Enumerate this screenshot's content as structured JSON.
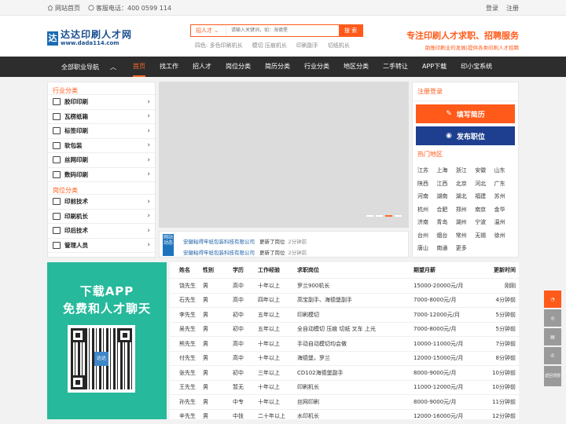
{
  "topbar": {
    "home": "网站首页",
    "phone": "客服电话：400 0599 114",
    "login": "登录",
    "register": "注册"
  },
  "header": {
    "logo_cn": "达达印刷人才网",
    "logo_en": "www.dada114.com",
    "search_type": "招人才",
    "search_placeholder": "请输入关键词，如：海德堡",
    "search_button": "搜 索",
    "hotwords": [
      "四色",
      "多色印刷机长",
      "模切",
      "压痕机长",
      "印刷副手",
      "切纸机长"
    ],
    "slogan_big": "专注印刷人才求职、招聘服务",
    "slogan_small": "助推印刷业的发展|提供各类印刷人才招聘"
  },
  "nav": {
    "all_categories": "全部职业导航",
    "items": [
      "首页",
      "找工作",
      "招人才",
      "岗位分类",
      "简历分类",
      "行业分类",
      "地区分类",
      "二手转让",
      "APP下载",
      "印小宝系统"
    ]
  },
  "categories": {
    "industry_title": "行业分类",
    "industry": [
      "胶印印刷",
      "瓦楞纸箱",
      "标签印刷",
      "软包装",
      "丝网印刷",
      "数码印刷"
    ],
    "position_title": "岗位分类",
    "positions": [
      "印前技术",
      "印刷机长",
      "印后技术",
      "管理人员"
    ]
  },
  "news": {
    "tag": "网站动态",
    "items": [
      {
        "company": "安徽粘得牢纸包装科技有限公司",
        "action": "更新了岗位",
        "time": "2分钟前"
      },
      {
        "company": "安徽粘得牢纸包装科技有限公司",
        "action": "更新了岗位",
        "time": "2分钟前"
      }
    ]
  },
  "side": {
    "login_title": "注册登录",
    "resume_button": "填写简历",
    "post_button": "发布职位",
    "hot_title": "热门地区",
    "cities": [
      "江苏",
      "上海",
      "浙江",
      "安徽",
      "山东",
      "陕西",
      "江西",
      "北京",
      "河北",
      "广东",
      "河南",
      "湖南",
      "湖北",
      "福建",
      "苏州",
      "杭州",
      "合肥",
      "郑州",
      "南京",
      "金华",
      "济南",
      "青岛",
      "湖州",
      "宁波",
      "温州",
      "台州",
      "烟台",
      "常州",
      "无锡",
      "徐州",
      "唐山",
      "南通",
      "更多"
    ]
  },
  "app": {
    "line1": "下载APP",
    "line2": "免费和人才聊天",
    "qr_label": "达达"
  },
  "table": {
    "headers": [
      "姓名",
      "性别",
      "学历",
      "工作经验",
      "求职岗位",
      "期望月薪",
      "更新时间"
    ],
    "rows": [
      [
        "饶先生",
        "男",
        "高中",
        "十年以上",
        "罗兰900机长",
        "15000-20000元/月",
        "刚刚"
      ],
      [
        "石先生",
        "男",
        "高中",
        "四年以上",
        "高宝副手、海德堡副手",
        "7000-8000元/月",
        "4分钟前"
      ],
      [
        "李先生",
        "男",
        "初中",
        "五年以上",
        "印刷模切",
        "7000-12000元/月",
        "5分钟前"
      ],
      [
        "吴先生",
        "男",
        "初中",
        "五年以上",
        "全自动模切 压痕 切纸 叉车 上光",
        "7000-8000元/月",
        "5分钟前"
      ],
      [
        "熊先生",
        "男",
        "高中",
        "十年以上",
        "手动自动模切均会做",
        "10000-11000元/月",
        "7分钟前"
      ],
      [
        "付先生",
        "男",
        "高中",
        "十年以上",
        "海德堡，罗兰",
        "12000-15000元/月",
        "8分钟前"
      ],
      [
        "张先生",
        "男",
        "初中",
        "三年以上",
        "CD102海德堡副手",
        "8000-9000元/月",
        "10分钟前"
      ],
      [
        "王先生",
        "男",
        "暂无",
        "十年以上",
        "印刷机长",
        "11000-12000元/月",
        "10分钟前"
      ],
      [
        "孙先生",
        "男",
        "中专",
        "十年以上",
        "丝网印刷",
        "8000-9000元/月",
        "11分钟前"
      ],
      [
        "辛先生",
        "男",
        "中技",
        "二十年以上",
        "水印机长",
        "12000-16000元/月",
        "12分钟前"
      ]
    ]
  },
  "float": {
    "top_label": "返回顶部"
  },
  "colors": {
    "accent": "#ff5a1a",
    "nav_bg": "#2d2d2d",
    "blue": "#1e3f8f",
    "green": "#27b99c"
  }
}
